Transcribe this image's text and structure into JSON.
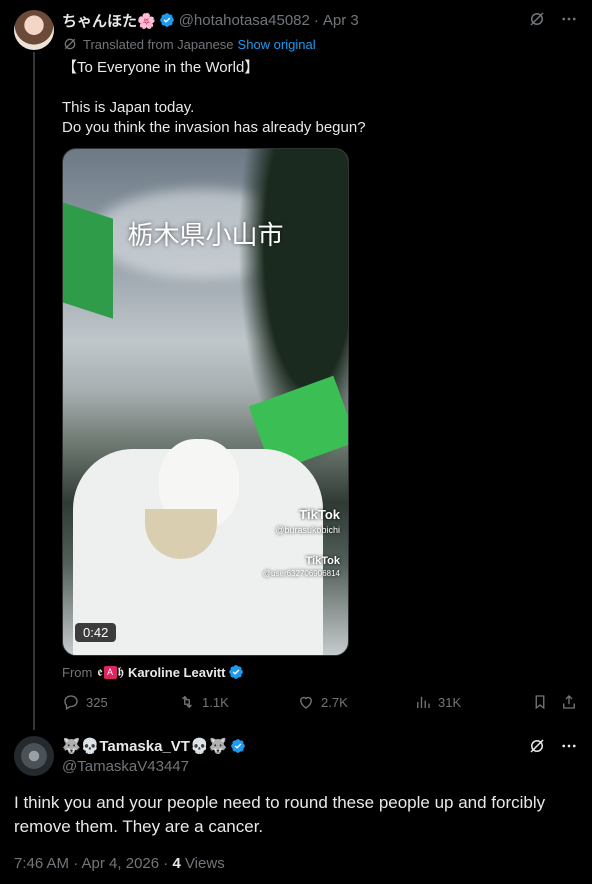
{
  "post": {
    "author_name": "ちゃんほた🌸",
    "handle": "@hotahotasa45082",
    "date": "Apr 3",
    "translated_label": "Translated from Japanese",
    "show_original": "Show original",
    "lines": [
      "【To Everyone in the World】",
      "",
      "This is Japan today.",
      "Do you think the invasion has already begun?"
    ],
    "media": {
      "caption": "栃木県小山市",
      "tiktok_1": "TikTok",
      "tiktok_1_user": "@burasukobichi",
      "tiktok_2": "TikTok",
      "tiktok_2_user": "@user632706906814",
      "duration": "0:42"
    },
    "from_label": "From",
    "from_prefix": "𝖊",
    "from_badge": "A",
    "from_glyph": "𝖍",
    "from_name": "Karoline Leavitt",
    "stats": {
      "replies": "325",
      "reposts": "1.1K",
      "likes": "2.7K",
      "views": "31K"
    }
  },
  "reply": {
    "author_name": "🐺💀Tamaska_VT💀🐺",
    "handle": "@TamaskaV43447",
    "text_lines": [
      "I think you and your people need to round these people up and forcibly",
      "remove them. They are a cancer."
    ],
    "time": "7:46 AM · Apr 4, 2026 · ",
    "views_count": "4",
    "views_label": " Views"
  },
  "colors": {
    "background": "#000000",
    "text": "#e7e9ea",
    "muted": "#71767b",
    "accent": "#1d9bf0",
    "verified": "#1d9bf0"
  },
  "icons": {
    "grok": "grok-icon",
    "more": "more-icon",
    "reply": "reply-icon",
    "repost": "repost-icon",
    "like": "heart-icon",
    "views": "views-icon",
    "bookmark": "bookmark-icon",
    "share": "share-icon"
  }
}
